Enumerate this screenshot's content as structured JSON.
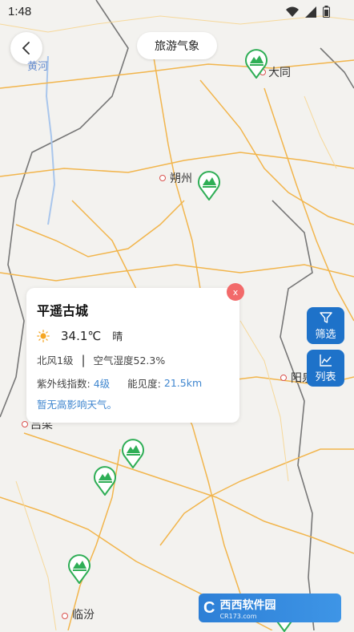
{
  "status_bar": {
    "time": "1:48"
  },
  "header": {
    "title": "旅游气象"
  },
  "map": {
    "cities": [
      {
        "name": "大同"
      },
      {
        "name": "朔州"
      },
      {
        "name": "阳泉"
      },
      {
        "name": "吕梁"
      },
      {
        "name": "临汾"
      }
    ],
    "river": "黄河"
  },
  "side_buttons": {
    "filter_label": "筛选",
    "list_label": "列表"
  },
  "info_card": {
    "title": "平遥古城",
    "temperature": "34.1℃",
    "condition": "晴",
    "wind": "北风1级",
    "humidity": "空气湿度52.3%",
    "uv_label": "紫外线指数:",
    "uv_value": "4级",
    "visibility_label": "能见度:",
    "visibility_value": "21.5km",
    "note": "暂无高影响天气。",
    "close_label": "x"
  },
  "watermark": {
    "logo": "C",
    "name": "西西软件园",
    "url": "CR173.com"
  },
  "colors": {
    "accent": "#1e72c9",
    "marker_green": "#2fae56",
    "road": "#f2b54c",
    "border": "#666666"
  }
}
